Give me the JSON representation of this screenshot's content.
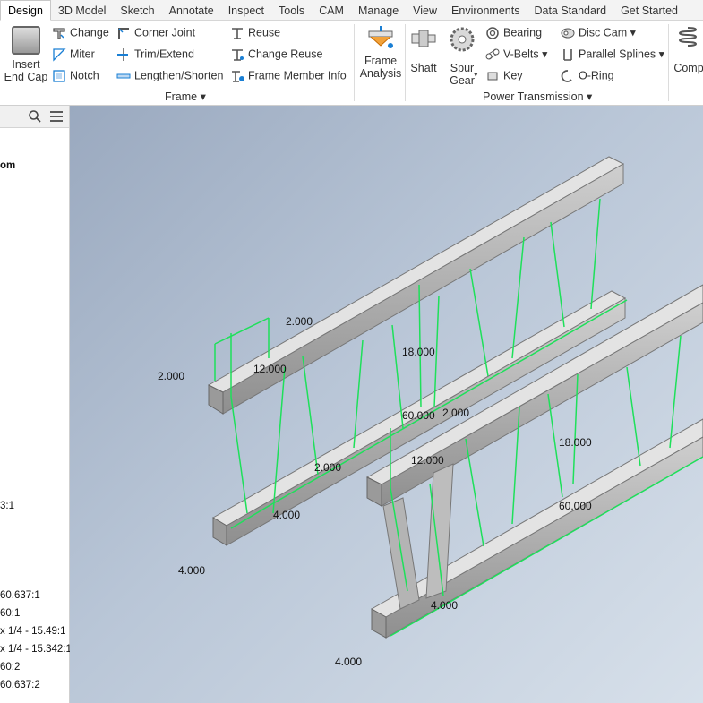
{
  "tabs": [
    "Design",
    "3D Model",
    "Sketch",
    "Annotate",
    "Inspect",
    "Tools",
    "CAM",
    "Manage",
    "View",
    "Environments",
    "Data Standard",
    "Get Started"
  ],
  "active_tab": "Design",
  "ribbon": {
    "insert_end_cap": [
      "Insert",
      "End Cap"
    ],
    "frame_buttons": {
      "change": "Change",
      "miter": "Miter",
      "notch": "Notch",
      "corner_joint": "Corner Joint",
      "trim_extend": "Trim/Extend",
      "lengthen_shorten": "Lengthen/Shorten",
      "reuse": "Reuse",
      "change_reuse": "Change Reuse",
      "frame_member_info": "Frame Member Info"
    },
    "frame_panel": "Frame",
    "frame_analysis": [
      "Frame",
      "Analysis"
    ],
    "shaft": "Shaft",
    "spur_gear": [
      "Spur",
      "Gear"
    ],
    "power_buttons": {
      "bearing": "Bearing",
      "v_belts": "V-Belts",
      "key": "Key",
      "disc_cam": "Disc Cam",
      "parallel_splines": "Parallel Splines",
      "o_ring": "O-Ring"
    },
    "power_panel": "Power Transmission",
    "comp": "Comp"
  },
  "browser": {
    "items": [
      "om",
      "3:1",
      "60.637:1",
      "60:1",
      "x 1/4 - 15.49:1",
      "x 1/4 - 15.342:1",
      "60:2",
      "60.637:2"
    ]
  },
  "dimensions": [
    "2.000",
    "2.000",
    "12.000",
    "18.000",
    "60.000",
    "2.000",
    "4.000",
    "4.000",
    "2.000",
    "12.000",
    "18.000",
    "60.000",
    "4.000",
    "4.000"
  ],
  "colors": {
    "dimension_line": "#1ee05a",
    "viewport_top": "#9aa9bf",
    "viewport_bottom": "#d7e0ea"
  }
}
